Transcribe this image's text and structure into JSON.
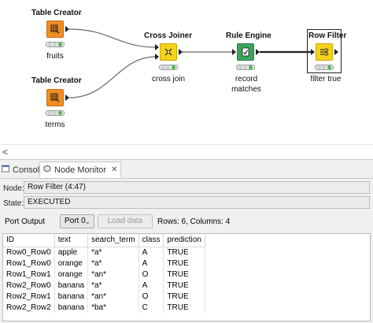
{
  "workflow": {
    "nodes": [
      {
        "id": "tc1",
        "title": "Table Creator",
        "label": "fruits"
      },
      {
        "id": "tc2",
        "title": "Table Creator",
        "label": "terms"
      },
      {
        "id": "cj",
        "title": "Cross Joiner",
        "label": "cross join"
      },
      {
        "id": "re",
        "title": "Rule Engine",
        "label": "record\nmatches"
      },
      {
        "id": "rf",
        "title": "Row Filter",
        "label": "filter true"
      }
    ]
  },
  "colors": {
    "table_creator": "#f08c24",
    "cross_joiner": "#f5d21a",
    "rule_engine": "#3aa55a",
    "row_filter": "#f5d21a",
    "status_green": "#4cb84c"
  },
  "scroll": {
    "left_arrow": "<"
  },
  "tabs": [
    {
      "label": "Console",
      "icon": "console-icon"
    },
    {
      "label": "Node Monitor",
      "icon": "node-monitor-icon",
      "active": true,
      "close": "✕"
    }
  ],
  "monitor": {
    "node_label": "Node:",
    "node_value": "Row Filter  (4:47)",
    "state_label": "State:",
    "state_value": "EXECUTED",
    "port_output_label": "Port Output",
    "port_selected": "Port 0",
    "load_data_label": "Load data",
    "rows_info": "Rows: 6, Columns: 4"
  },
  "table": {
    "columns": [
      "ID",
      "text",
      "search_term",
      "class",
      "prediction"
    ],
    "rows": [
      [
        "Row0_Row0",
        "apple",
        "*a*",
        "A",
        "TRUE"
      ],
      [
        "Row1_Row0",
        "orange",
        "*a*",
        "A",
        "TRUE"
      ],
      [
        "Row1_Row1",
        "orange",
        "*an*",
        "O",
        "TRUE"
      ],
      [
        "Row2_Row0",
        "banana",
        "*a*",
        "A",
        "TRUE"
      ],
      [
        "Row2_Row1",
        "banana",
        "*an*",
        "O",
        "TRUE"
      ],
      [
        "Row2_Row2",
        "banana",
        "*ba*",
        "C",
        "TRUE"
      ]
    ]
  }
}
